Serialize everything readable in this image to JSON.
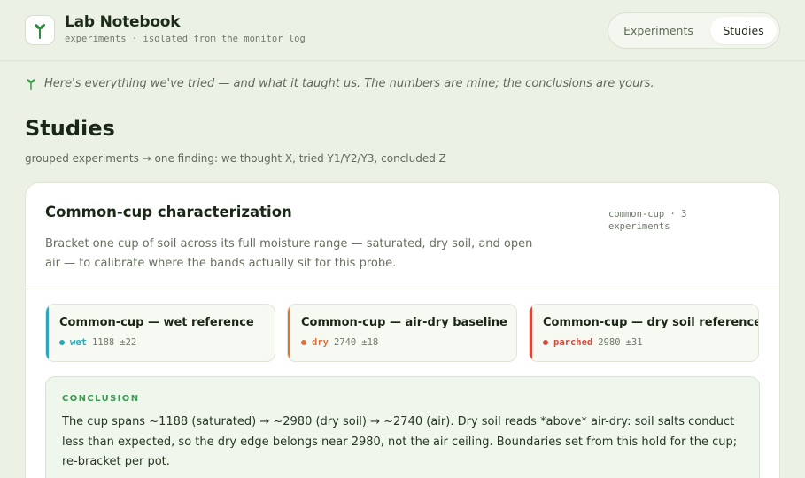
{
  "header": {
    "title": "Lab Notebook",
    "subtitle": "experiments · isolated from the monitor log",
    "logo_icon": "sprout-icon",
    "nav": [
      {
        "label": "Experiments",
        "active": false
      },
      {
        "label": "Studies",
        "active": true
      }
    ]
  },
  "intro": {
    "icon": "sprout-icon",
    "tagline": "Here's everything we've tried — and what it taught us. The numbers are mine; the conclusions are yours."
  },
  "page": {
    "title": "Studies",
    "subtitle": "grouped experiments → one finding: we thought X, tried Y1/Y2/Y3, concluded Z"
  },
  "study": {
    "title": "Common-cup characterization",
    "meta": "common-cup · 3 experiments",
    "description": "Bracket one cup of soil across its full moisture range — saturated, dry soil, and open air — to calibrate where the bands actually sit for this probe.",
    "experiments": [
      {
        "title": "Common-cup — wet reference",
        "band": "wet",
        "value": "1188",
        "spread": "±22",
        "color": "#29a9b9"
      },
      {
        "title": "Common-cup — air-dry baseline",
        "band": "dry",
        "value": "2740",
        "spread": "±18",
        "color": "#e0703a"
      },
      {
        "title": "Common-cup — dry soil reference",
        "band": "parched",
        "value": "2980",
        "spread": "±31",
        "color": "#d94a3c"
      }
    ],
    "conclusion": {
      "label": "CONCLUSION",
      "text": "The cup spans ~1188 (saturated) → ~2980 (dry soil) → ~2740 (air). Dry soil reads *above* air-dry: soil salts conduct less than expected, so the dry edge belongs near 2980, not the air ceiling. Boundaries set from this hold for the cup; re-bracket per pot."
    }
  }
}
